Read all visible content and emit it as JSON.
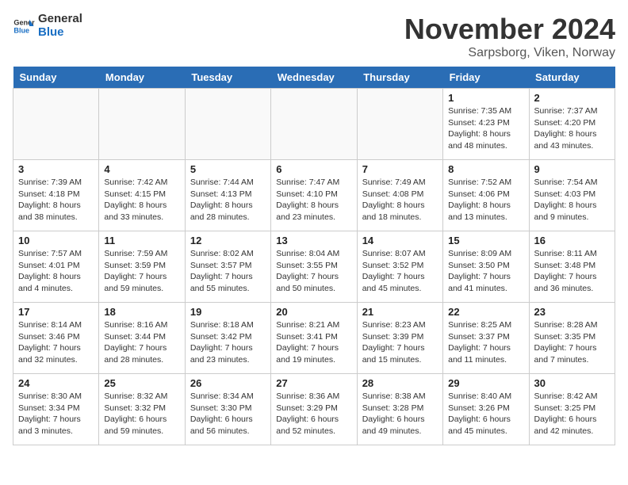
{
  "logo": {
    "text_general": "General",
    "text_blue": "Blue"
  },
  "title": "November 2024",
  "location": "Sarpsborg, Viken, Norway",
  "weekdays": [
    "Sunday",
    "Monday",
    "Tuesday",
    "Wednesday",
    "Thursday",
    "Friday",
    "Saturday"
  ],
  "weeks": [
    [
      {
        "day": "",
        "info": ""
      },
      {
        "day": "",
        "info": ""
      },
      {
        "day": "",
        "info": ""
      },
      {
        "day": "",
        "info": ""
      },
      {
        "day": "",
        "info": ""
      },
      {
        "day": "1",
        "info": "Sunrise: 7:35 AM\nSunset: 4:23 PM\nDaylight: 8 hours\nand 48 minutes."
      },
      {
        "day": "2",
        "info": "Sunrise: 7:37 AM\nSunset: 4:20 PM\nDaylight: 8 hours\nand 43 minutes."
      }
    ],
    [
      {
        "day": "3",
        "info": "Sunrise: 7:39 AM\nSunset: 4:18 PM\nDaylight: 8 hours\nand 38 minutes."
      },
      {
        "day": "4",
        "info": "Sunrise: 7:42 AM\nSunset: 4:15 PM\nDaylight: 8 hours\nand 33 minutes."
      },
      {
        "day": "5",
        "info": "Sunrise: 7:44 AM\nSunset: 4:13 PM\nDaylight: 8 hours\nand 28 minutes."
      },
      {
        "day": "6",
        "info": "Sunrise: 7:47 AM\nSunset: 4:10 PM\nDaylight: 8 hours\nand 23 minutes."
      },
      {
        "day": "7",
        "info": "Sunrise: 7:49 AM\nSunset: 4:08 PM\nDaylight: 8 hours\nand 18 minutes."
      },
      {
        "day": "8",
        "info": "Sunrise: 7:52 AM\nSunset: 4:06 PM\nDaylight: 8 hours\nand 13 minutes."
      },
      {
        "day": "9",
        "info": "Sunrise: 7:54 AM\nSunset: 4:03 PM\nDaylight: 8 hours\nand 9 minutes."
      }
    ],
    [
      {
        "day": "10",
        "info": "Sunrise: 7:57 AM\nSunset: 4:01 PM\nDaylight: 8 hours\nand 4 minutes."
      },
      {
        "day": "11",
        "info": "Sunrise: 7:59 AM\nSunset: 3:59 PM\nDaylight: 7 hours\nand 59 minutes."
      },
      {
        "day": "12",
        "info": "Sunrise: 8:02 AM\nSunset: 3:57 PM\nDaylight: 7 hours\nand 55 minutes."
      },
      {
        "day": "13",
        "info": "Sunrise: 8:04 AM\nSunset: 3:55 PM\nDaylight: 7 hours\nand 50 minutes."
      },
      {
        "day": "14",
        "info": "Sunrise: 8:07 AM\nSunset: 3:52 PM\nDaylight: 7 hours\nand 45 minutes."
      },
      {
        "day": "15",
        "info": "Sunrise: 8:09 AM\nSunset: 3:50 PM\nDaylight: 7 hours\nand 41 minutes."
      },
      {
        "day": "16",
        "info": "Sunrise: 8:11 AM\nSunset: 3:48 PM\nDaylight: 7 hours\nand 36 minutes."
      }
    ],
    [
      {
        "day": "17",
        "info": "Sunrise: 8:14 AM\nSunset: 3:46 PM\nDaylight: 7 hours\nand 32 minutes."
      },
      {
        "day": "18",
        "info": "Sunrise: 8:16 AM\nSunset: 3:44 PM\nDaylight: 7 hours\nand 28 minutes."
      },
      {
        "day": "19",
        "info": "Sunrise: 8:18 AM\nSunset: 3:42 PM\nDaylight: 7 hours\nand 23 minutes."
      },
      {
        "day": "20",
        "info": "Sunrise: 8:21 AM\nSunset: 3:41 PM\nDaylight: 7 hours\nand 19 minutes."
      },
      {
        "day": "21",
        "info": "Sunrise: 8:23 AM\nSunset: 3:39 PM\nDaylight: 7 hours\nand 15 minutes."
      },
      {
        "day": "22",
        "info": "Sunrise: 8:25 AM\nSunset: 3:37 PM\nDaylight: 7 hours\nand 11 minutes."
      },
      {
        "day": "23",
        "info": "Sunrise: 8:28 AM\nSunset: 3:35 PM\nDaylight: 7 hours\nand 7 minutes."
      }
    ],
    [
      {
        "day": "24",
        "info": "Sunrise: 8:30 AM\nSunset: 3:34 PM\nDaylight: 7 hours\nand 3 minutes."
      },
      {
        "day": "25",
        "info": "Sunrise: 8:32 AM\nSunset: 3:32 PM\nDaylight: 6 hours\nand 59 minutes."
      },
      {
        "day": "26",
        "info": "Sunrise: 8:34 AM\nSunset: 3:30 PM\nDaylight: 6 hours\nand 56 minutes."
      },
      {
        "day": "27",
        "info": "Sunrise: 8:36 AM\nSunset: 3:29 PM\nDaylight: 6 hours\nand 52 minutes."
      },
      {
        "day": "28",
        "info": "Sunrise: 8:38 AM\nSunset: 3:28 PM\nDaylight: 6 hours\nand 49 minutes."
      },
      {
        "day": "29",
        "info": "Sunrise: 8:40 AM\nSunset: 3:26 PM\nDaylight: 6 hours\nand 45 minutes."
      },
      {
        "day": "30",
        "info": "Sunrise: 8:42 AM\nSunset: 3:25 PM\nDaylight: 6 hours\nand 42 minutes."
      }
    ]
  ]
}
